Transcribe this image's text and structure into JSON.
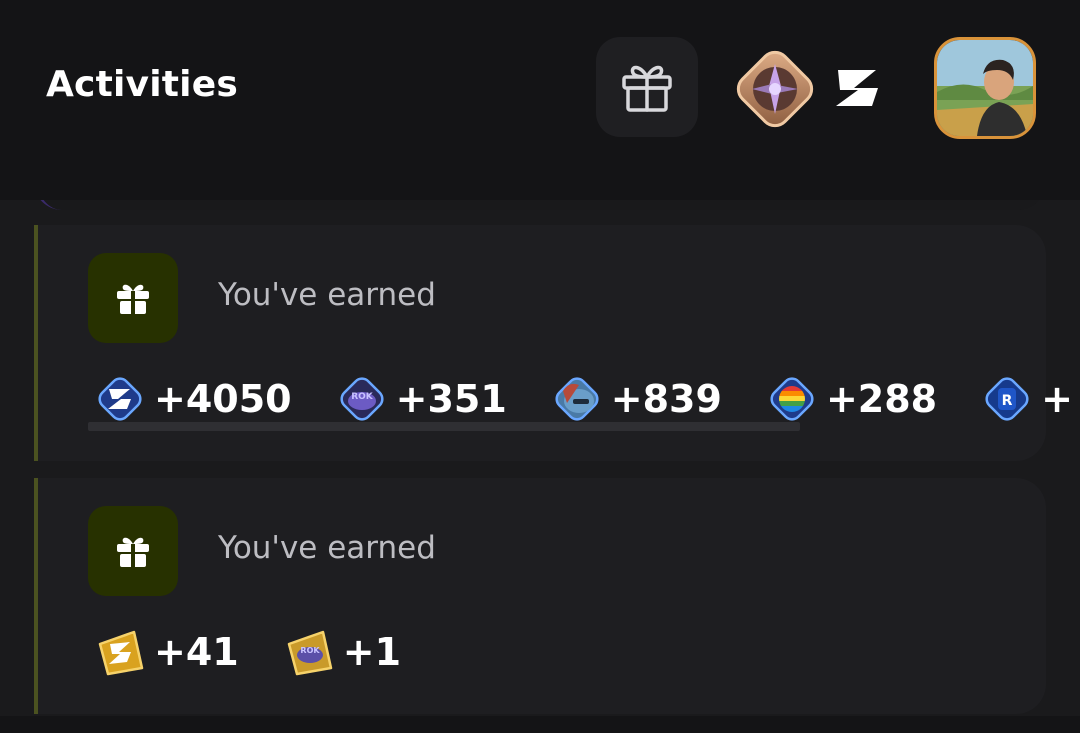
{
  "header": {
    "title": "Activities",
    "gift_icon": "gift-icon",
    "rank_badge_icon": "rank-badge-icon",
    "brand_logo_icon": "z-logo-icon",
    "avatar_icon": "avatar"
  },
  "activities": [
    {
      "icon": "gift-icon",
      "text": "You've earned",
      "rewards": [
        {
          "icon": "z-token-icon",
          "amount": "+4050"
        },
        {
          "icon": "rok-token-icon",
          "amount": "+351"
        },
        {
          "icon": "pepe-token-icon",
          "amount": "+839"
        },
        {
          "icon": "rainbow-token-icon",
          "amount": "+288"
        },
        {
          "icon": "r-token-icon",
          "amount": "+"
        }
      ]
    },
    {
      "icon": "gift-icon",
      "text": "You've earned",
      "rewards": [
        {
          "icon": "z-gold-token-icon",
          "amount": "+41"
        },
        {
          "icon": "rok-gold-token-icon",
          "amount": "+1"
        }
      ]
    }
  ],
  "colors": {
    "background": "#1a1a1c",
    "header": "#141416",
    "card": "#1e1e21",
    "card_accent": "#4b5220",
    "icon_bg": "#273100",
    "muted_text": "#bdbdc2",
    "avatar_border": "#d9933a"
  }
}
